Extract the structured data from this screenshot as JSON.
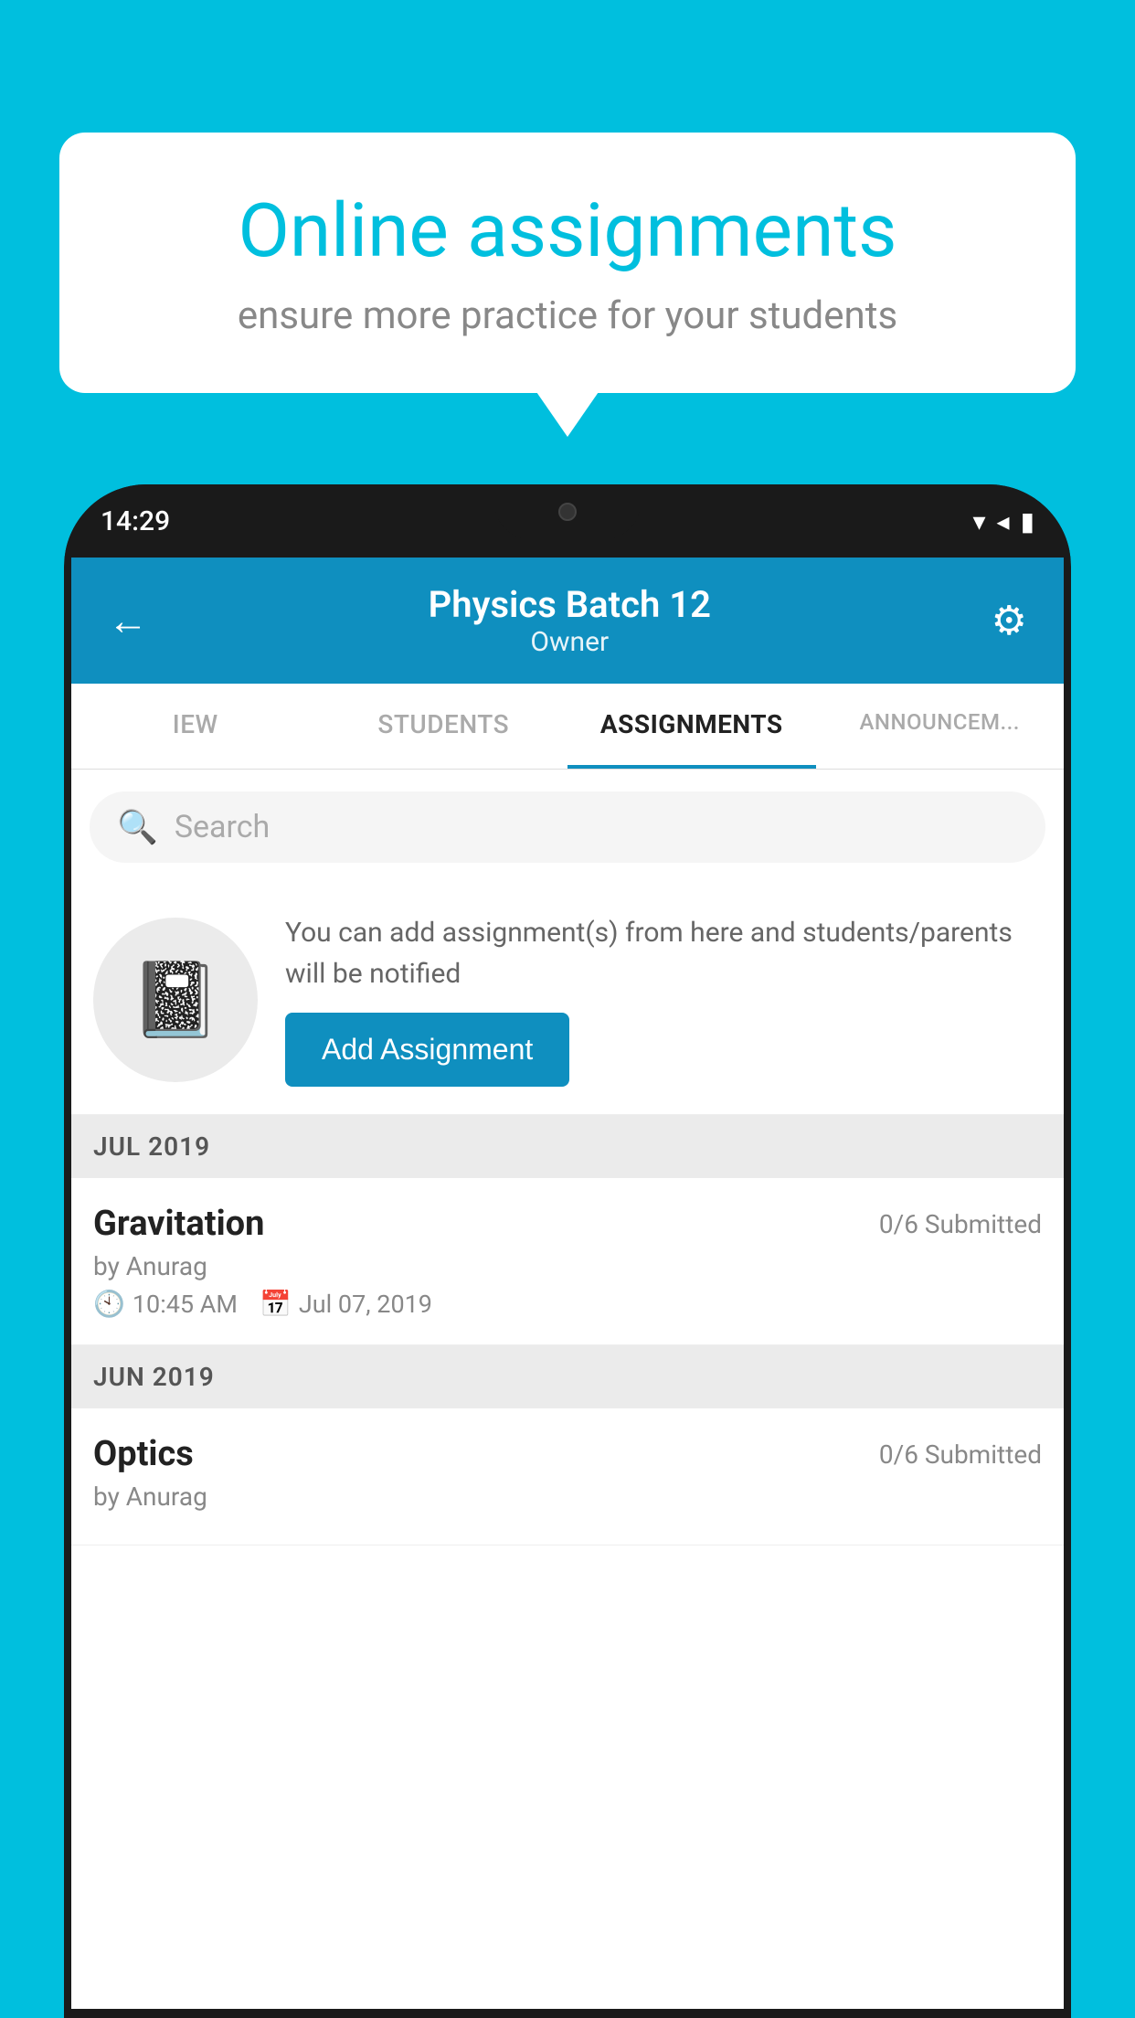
{
  "background_color": "#00BFDE",
  "speech_bubble": {
    "title": "Online assignments",
    "subtitle": "ensure more practice for your students"
  },
  "status_bar": {
    "time": "14:29",
    "icons": [
      "wifi",
      "signal",
      "battery"
    ]
  },
  "app_header": {
    "title": "Physics Batch 12",
    "subtitle": "Owner",
    "back_label": "←",
    "settings_label": "⚙"
  },
  "tabs": [
    {
      "label": "IEW",
      "active": false
    },
    {
      "label": "STUDENTS",
      "active": false
    },
    {
      "label": "ASSIGNMENTS",
      "active": true
    },
    {
      "label": "ANNOUNCEM...",
      "active": false
    }
  ],
  "search": {
    "placeholder": "Search"
  },
  "add_assignment_section": {
    "description_text": "You can add assignment(s) from here and students/parents will be notified",
    "button_label": "Add Assignment"
  },
  "sections": [
    {
      "header": "JUL 2019",
      "assignments": [
        {
          "name": "Gravitation",
          "submitted": "0/6 Submitted",
          "by": "by Anurag",
          "time": "10:45 AM",
          "date": "Jul 07, 2019"
        }
      ]
    },
    {
      "header": "JUN 2019",
      "assignments": [
        {
          "name": "Optics",
          "submitted": "0/6 Submitted",
          "by": "by Anurag",
          "time": "",
          "date": ""
        }
      ]
    }
  ]
}
